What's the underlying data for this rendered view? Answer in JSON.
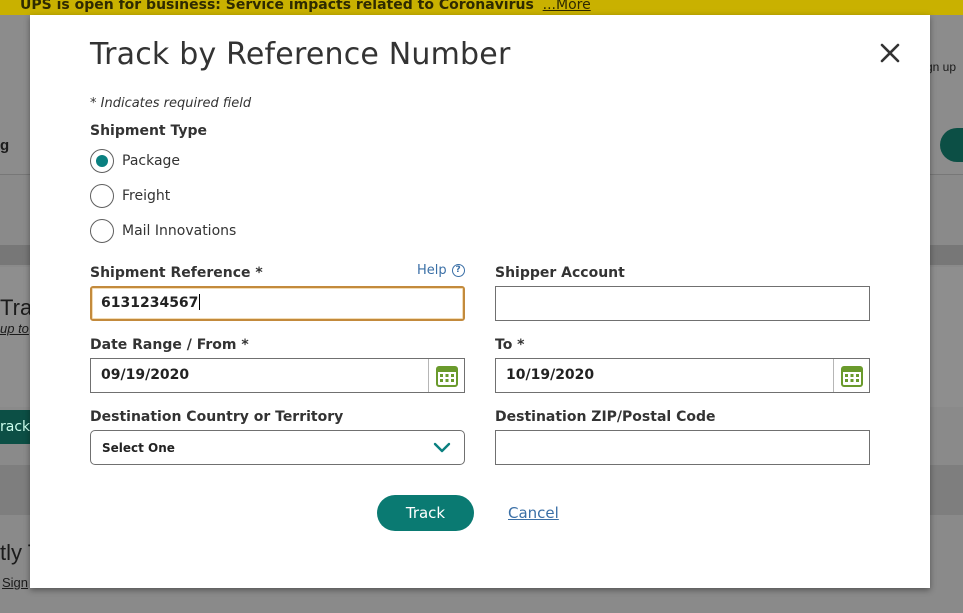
{
  "banner": {
    "text": "UPS is open for business: Service impacts related to Coronavirus",
    "more": "...More"
  },
  "background": {
    "sign_up": "gn up",
    "left_nav": "g",
    "track_heading": "Trac",
    "track_sub": "up to",
    "track_btn": "rack",
    "recent": "tly T",
    "sign": "Sign"
  },
  "modal": {
    "title": "Track by Reference Number",
    "required_note": "* Indicates required field",
    "shipment_type_label": "Shipment Type",
    "shipment_types": [
      {
        "label": "Package",
        "checked": true
      },
      {
        "label": "Freight",
        "checked": false
      },
      {
        "label": "Mail Innovations",
        "checked": false
      }
    ],
    "shipment_reference": {
      "label": "Shipment Reference *",
      "value": "6131234567"
    },
    "help": {
      "label": "Help",
      "icon": "?"
    },
    "shipper_account": {
      "label": "Shipper Account",
      "value": ""
    },
    "date_from": {
      "label": "Date Range / From *",
      "value": "09/19/2020"
    },
    "date_to": {
      "label": "To *",
      "value": "10/19/2020"
    },
    "destination_country": {
      "label": "Destination Country or Territory",
      "value": "Select One"
    },
    "destination_zip": {
      "label": "Destination ZIP/Postal Code",
      "value": ""
    },
    "track_button": "Track",
    "cancel_link": "Cancel"
  },
  "colors": {
    "accent": "#0a7a72",
    "radio_checked": "#0a8080",
    "calendar_icon": "#6a9a2c",
    "link": "#3a6fa6",
    "focus_border": "#c38a3c"
  }
}
